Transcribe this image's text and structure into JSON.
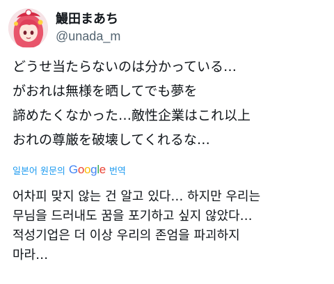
{
  "user": {
    "display_name": "鰻田まあち",
    "handle": "@unada_m",
    "avatar_icon": "anime-avatar-icon"
  },
  "tweet": {
    "lines": [
      "どうせ当たらないのは分かっている…",
      "がおれは無様を晒してでも夢を",
      "諦めたくなかった…敵性企業はこれ以上",
      "おれの尊厳を破壊してくれるな…"
    ]
  },
  "translation": {
    "prefix": "일본어 원문의",
    "google_letters": [
      "G",
      "o",
      "o",
      "g",
      "l",
      "e"
    ],
    "google_colors": [
      "#4285f4",
      "#ea4335",
      "#fbbc05",
      "#4285f4",
      "#34a853",
      "#ea4335"
    ],
    "suffix": "번역",
    "lines": [
      "어차피 맞지 않는 건 알고 있다… 하지만 우리는",
      "무님을 드러내도 꿈을 포기하고 싶지 않았다…",
      "적성기업은 더 이상 우리의 존엄을 파괴하지",
      "마라…"
    ]
  },
  "colors": {
    "text": "#0f1419",
    "muted": "#536471",
    "link": "#1d9bf0"
  }
}
